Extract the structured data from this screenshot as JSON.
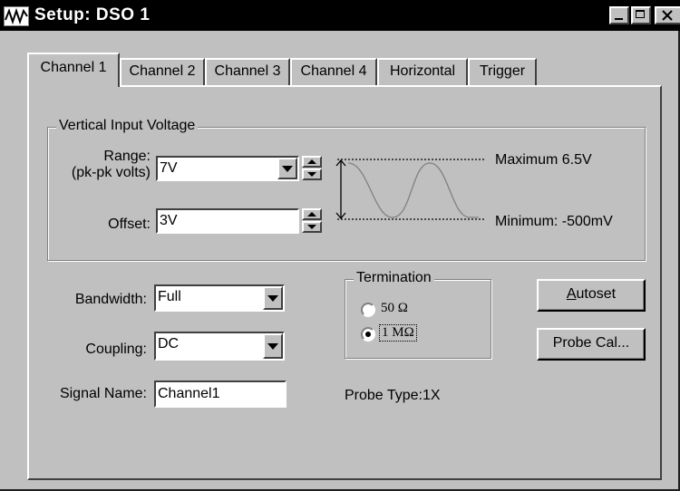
{
  "window": {
    "title": "Setup: DSO 1"
  },
  "tabs": [
    {
      "label": "Channel 1",
      "active": true
    },
    {
      "label": "Channel 2",
      "active": false
    },
    {
      "label": "Channel 3",
      "active": false
    },
    {
      "label": "Channel 4",
      "active": false
    },
    {
      "label": "Horizontal",
      "active": false
    },
    {
      "label": "Trigger",
      "active": false
    }
  ],
  "vertical": {
    "group_label": "Vertical Input Voltage",
    "range_label_1": "Range:",
    "range_label_2": "(pk-pk volts)",
    "range_value": "7V",
    "offset_label": "Offset:",
    "offset_value": "3V",
    "maximum_text": "Maximum  6.5V",
    "minimum_text": "Minimum:  -500mV"
  },
  "bandwidth": {
    "label": "Bandwidth:",
    "value": "Full"
  },
  "coupling": {
    "label": "Coupling:",
    "value": "DC"
  },
  "signal_name": {
    "label": "Signal Name:",
    "value": "Channel1"
  },
  "termination": {
    "group_label": "Termination",
    "options": [
      {
        "label": "50 Ω",
        "selected": false
      },
      {
        "label": "1 MΩ",
        "selected": true
      }
    ]
  },
  "buttons": {
    "autoset_prefix": "A",
    "autoset_rest": "utoset",
    "probe_cal": "Probe Cal..."
  },
  "probe_type": "Probe Type:1X",
  "colors": {
    "title_bar": "#000000",
    "face": "#c0c0c0",
    "waveform": "#808080"
  }
}
